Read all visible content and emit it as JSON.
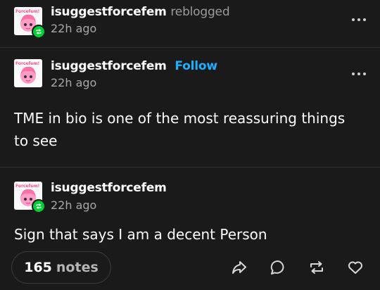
{
  "reblog_header": {
    "username": "isuggestforcefem",
    "action": "reblogged",
    "time": "22h ago",
    "avatar_text": "Forcefem!"
  },
  "original_post": {
    "username": "isuggestforcefem",
    "follow_label": "Follow",
    "time": "22h ago",
    "avatar_text": "Forcefem!",
    "body_line1": "TME in bio is one of the most reassuring things",
    "body_line2": "to see"
  },
  "reblog_post": {
    "username": "isuggestforcefem",
    "time": "22h ago",
    "avatar_text": "Forcefem!",
    "body": "Sign that says I am a decent Person"
  },
  "footer": {
    "notes_count": "165",
    "notes_label": "notes",
    "actions": [
      "share-icon",
      "reply-icon",
      "reblog-icon",
      "like-icon"
    ]
  },
  "colors": {
    "background": "#1a1a1a",
    "follow": "#1eb0ff",
    "reblog_badge": "#00cf35",
    "muted": "#9b9b9b"
  }
}
